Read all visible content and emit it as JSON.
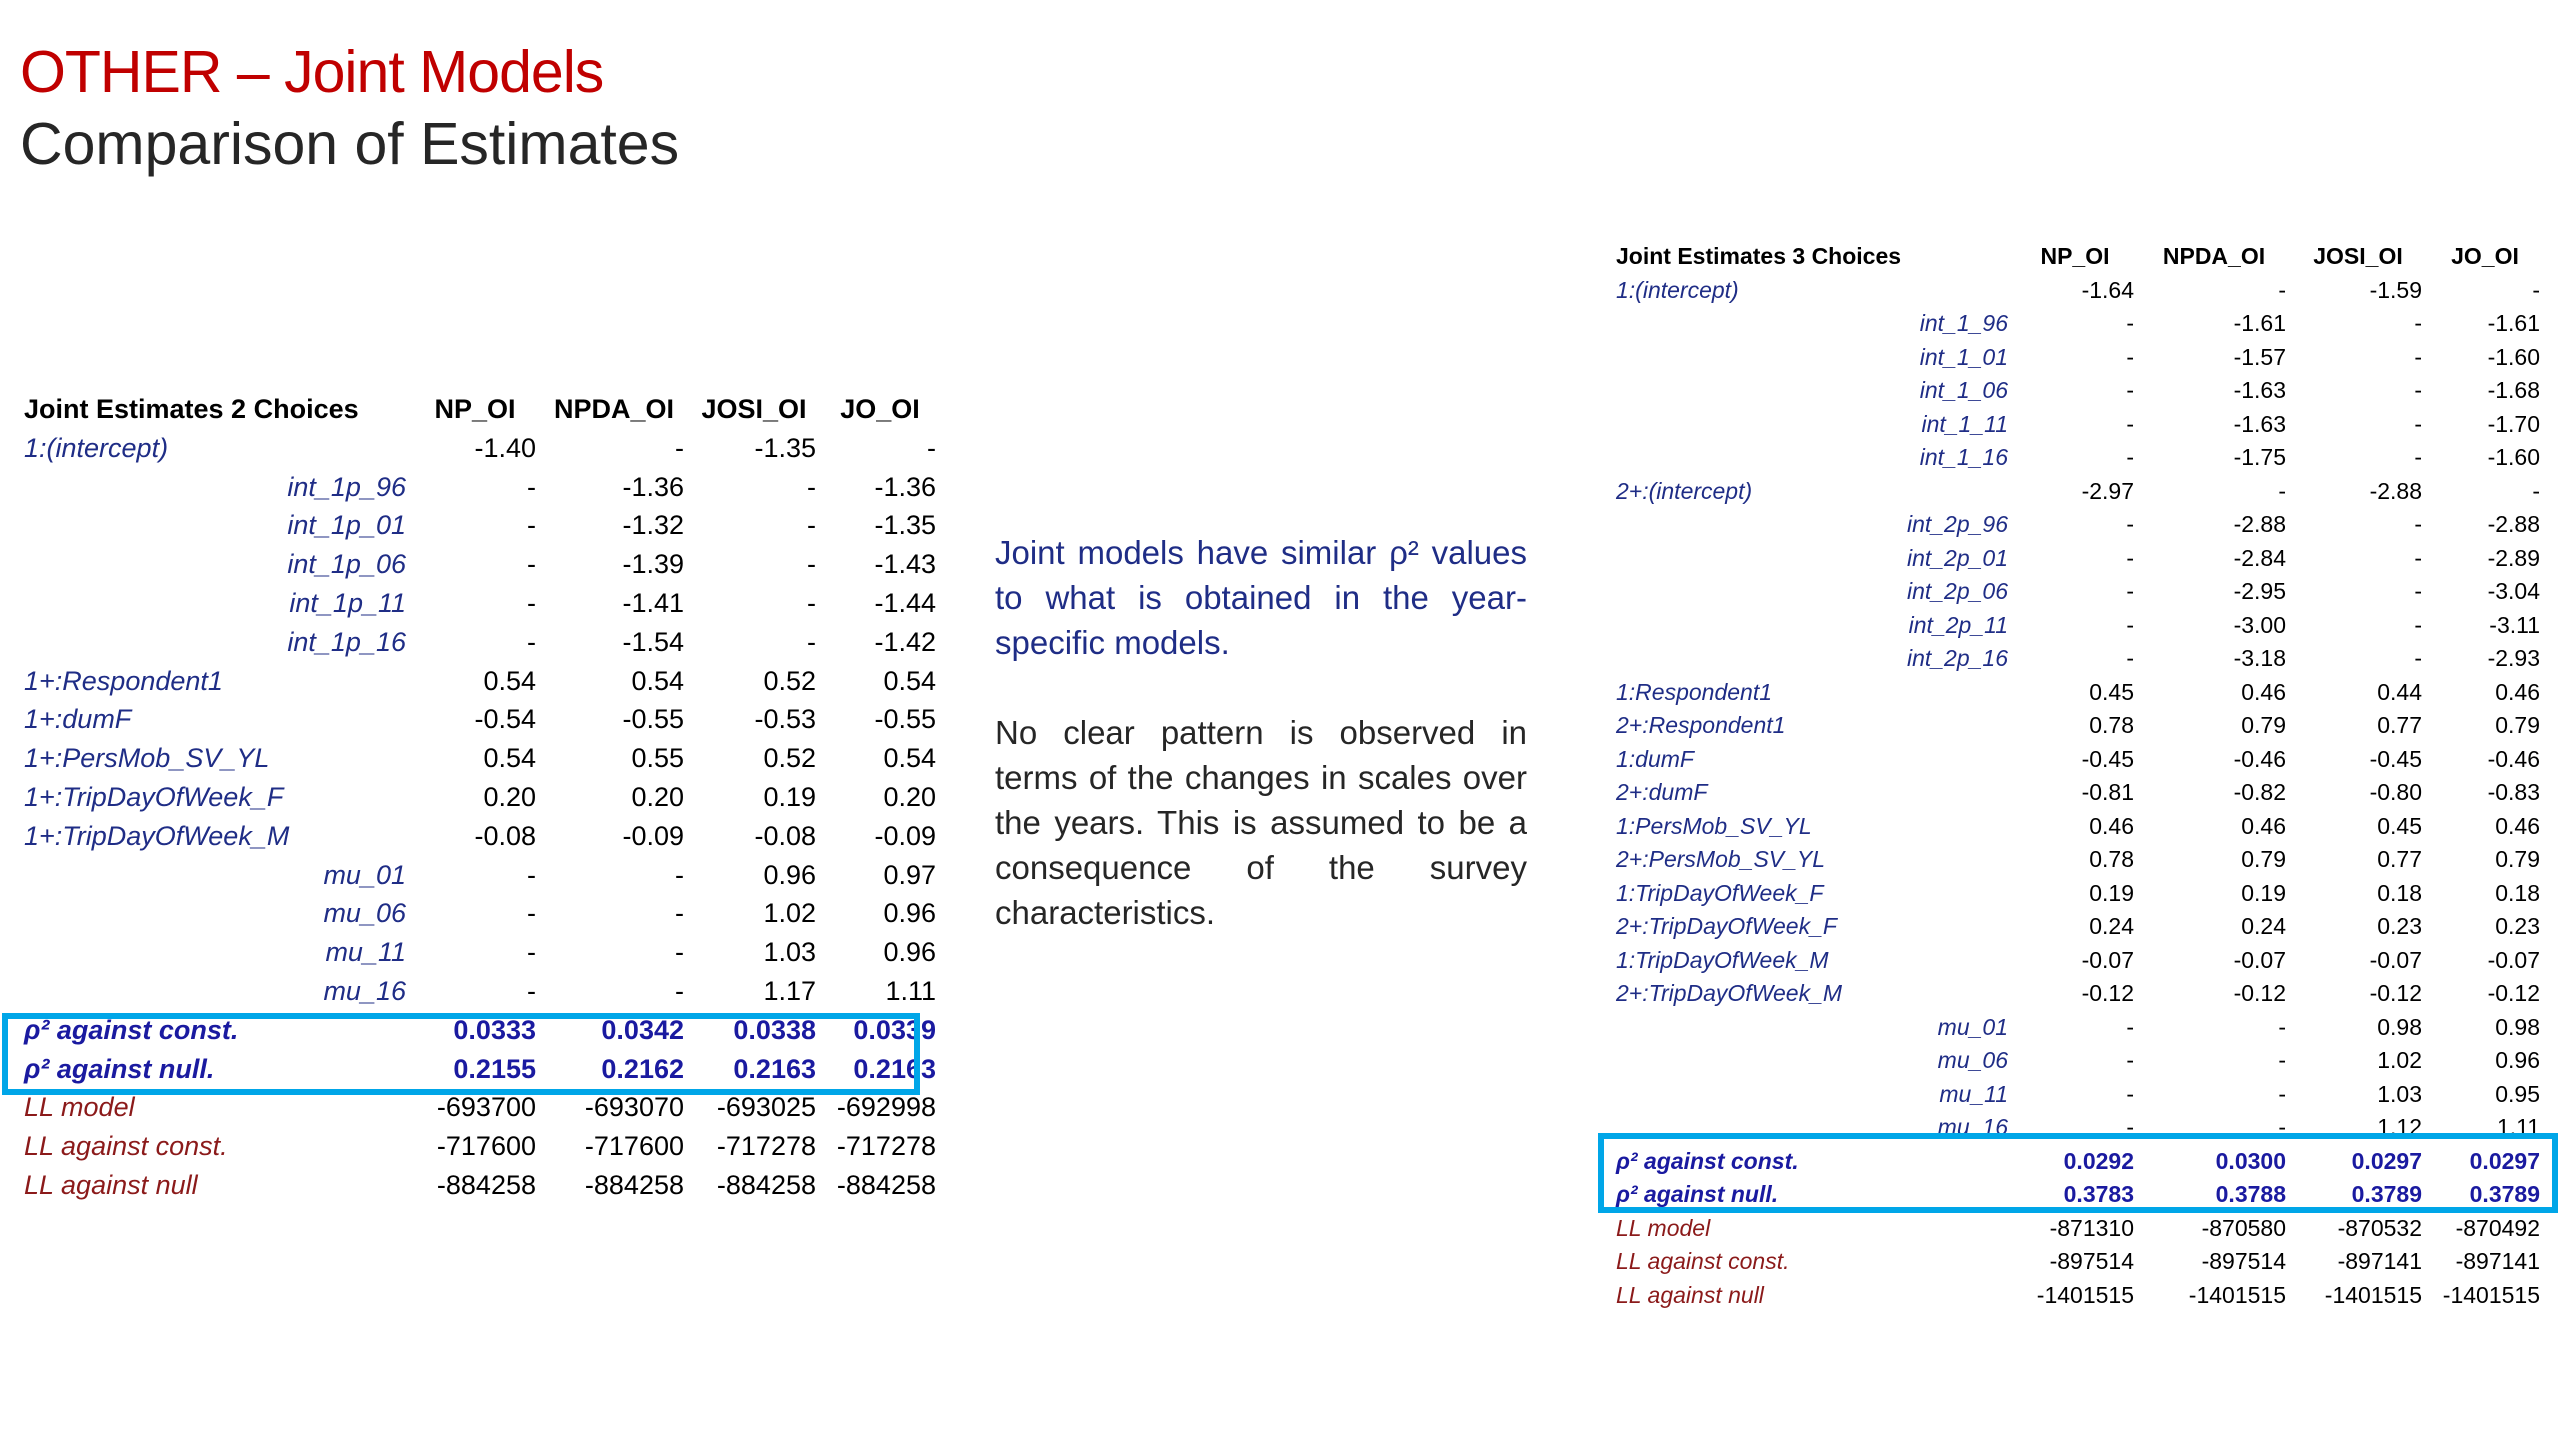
{
  "slide": {
    "title": "OTHER – Joint Models",
    "subtitle": "Comparison of Estimates",
    "paragraph1": "Joint models have similar ρ² values to what is obtained in the year-specific models.",
    "paragraph2": "No clear pattern is observed in terms of the changes in scales over the years. This is assumed to be a consequence of the survey characteristics."
  },
  "left_table": {
    "header": [
      "Joint Estimates 2 Choices",
      "NP_OI",
      "NPDA_OI",
      "JOSI_OI",
      "JO_OI"
    ],
    "rows": [
      {
        "label": "1:(intercept)",
        "values": [
          "-1.40",
          "-",
          "-1.35",
          "-"
        ]
      },
      {
        "label": "int_1p_96",
        "values": [
          "-",
          "-1.36",
          "-",
          "-1.36"
        ]
      },
      {
        "label": "int_1p_01",
        "values": [
          "-",
          "-1.32",
          "-",
          "-1.35"
        ]
      },
      {
        "label": "int_1p_06",
        "values": [
          "-",
          "-1.39",
          "-",
          "-1.43"
        ]
      },
      {
        "label": "int_1p_11",
        "values": [
          "-",
          "-1.41",
          "-",
          "-1.44"
        ]
      },
      {
        "label": "int_1p_16",
        "values": [
          "-",
          "-1.54",
          "-",
          "-1.42"
        ]
      },
      {
        "label": "1+:Respondent1",
        "values": [
          "0.54",
          "0.54",
          "0.52",
          "0.54"
        ]
      },
      {
        "label": "1+:dumF",
        "values": [
          "-0.54",
          "-0.55",
          "-0.53",
          "-0.55"
        ]
      },
      {
        "label": "1+:PersMob_SV_YL",
        "values": [
          "0.54",
          "0.55",
          "0.52",
          "0.54"
        ]
      },
      {
        "label": "1+:TripDayOfWeek_F",
        "values": [
          "0.20",
          "0.20",
          "0.19",
          "0.20"
        ]
      },
      {
        "label": "1+:TripDayOfWeek_M",
        "values": [
          "-0.08",
          "-0.09",
          "-0.08",
          "-0.09"
        ]
      },
      {
        "label": "mu_01",
        "values": [
          "-",
          "-",
          "0.96",
          "0.97"
        ]
      },
      {
        "label": "mu_06",
        "values": [
          "-",
          "-",
          "1.02",
          "0.96"
        ]
      },
      {
        "label": "mu_11",
        "values": [
          "-",
          "-",
          "1.03",
          "0.96"
        ]
      },
      {
        "label": "mu_16",
        "values": [
          "-",
          "-",
          "1.17",
          "1.11"
        ]
      },
      {
        "label": "ρ² against const.",
        "values": [
          "0.0333",
          "0.0342",
          "0.0338",
          "0.0339"
        ]
      },
      {
        "label": "ρ² against null.",
        "values": [
          "0.2155",
          "0.2162",
          "0.2163",
          "0.2163"
        ]
      },
      {
        "label": "LL model",
        "values": [
          "-693700",
          "-693070",
          "-693025",
          "-692998"
        ]
      },
      {
        "label": "LL against const.",
        "values": [
          "-717600",
          "-717600",
          "-717278",
          "-717278"
        ]
      },
      {
        "label": "LL against null",
        "values": [
          "-884258",
          "-884258",
          "-884258",
          "-884258"
        ]
      }
    ]
  },
  "right_table": {
    "header": [
      "Joint Estimates 3 Choices",
      "NP_OI",
      "NPDA_OI",
      "JOSI_OI",
      "JO_OI"
    ],
    "rows": [
      {
        "label": "1:(intercept)",
        "values": [
          "-1.64",
          "-",
          "-1.59",
          "-"
        ]
      },
      {
        "label": "int_1_96",
        "values": [
          "-",
          "-1.61",
          "-",
          "-1.61"
        ]
      },
      {
        "label": "int_1_01",
        "values": [
          "-",
          "-1.57",
          "-",
          "-1.60"
        ]
      },
      {
        "label": "int_1_06",
        "values": [
          "-",
          "-1.63",
          "-",
          "-1.68"
        ]
      },
      {
        "label": "int_1_11",
        "values": [
          "-",
          "-1.63",
          "-",
          "-1.70"
        ]
      },
      {
        "label": "int_1_16",
        "values": [
          "-",
          "-1.75",
          "-",
          "-1.60"
        ]
      },
      {
        "label": "2+:(intercept)",
        "values": [
          "-2.97",
          "-",
          "-2.88",
          "-"
        ]
      },
      {
        "label": "int_2p_96",
        "values": [
          "-",
          "-2.88",
          "-",
          "-2.88"
        ]
      },
      {
        "label": "int_2p_01",
        "values": [
          "-",
          "-2.84",
          "-",
          "-2.89"
        ]
      },
      {
        "label": "int_2p_06",
        "values": [
          "-",
          "-2.95",
          "-",
          "-3.04"
        ]
      },
      {
        "label": "int_2p_11",
        "values": [
          "-",
          "-3.00",
          "-",
          "-3.11"
        ]
      },
      {
        "label": "int_2p_16",
        "values": [
          "-",
          "-3.18",
          "-",
          "-2.93"
        ]
      },
      {
        "label": "1:Respondent1",
        "values": [
          "0.45",
          "0.46",
          "0.44",
          "0.46"
        ]
      },
      {
        "label": "2+:Respondent1",
        "values": [
          "0.78",
          "0.79",
          "0.77",
          "0.79"
        ]
      },
      {
        "label": "1:dumF",
        "values": [
          "-0.45",
          "-0.46",
          "-0.45",
          "-0.46"
        ]
      },
      {
        "label": "2+:dumF",
        "values": [
          "-0.81",
          "-0.82",
          "-0.80",
          "-0.83"
        ]
      },
      {
        "label": "1:PersMob_SV_YL",
        "values": [
          "0.46",
          "0.46",
          "0.45",
          "0.46"
        ]
      },
      {
        "label": "2+:PersMob_SV_YL",
        "values": [
          "0.78",
          "0.79",
          "0.77",
          "0.79"
        ]
      },
      {
        "label": "1:TripDayOfWeek_F",
        "values": [
          "0.19",
          "0.19",
          "0.18",
          "0.18"
        ]
      },
      {
        "label": "2+:TripDayOfWeek_F",
        "values": [
          "0.24",
          "0.24",
          "0.23",
          "0.23"
        ]
      },
      {
        "label": "1:TripDayOfWeek_M",
        "values": [
          "-0.07",
          "-0.07",
          "-0.07",
          "-0.07"
        ]
      },
      {
        "label": "2+:TripDayOfWeek_M",
        "values": [
          "-0.12",
          "-0.12",
          "-0.12",
          "-0.12"
        ]
      },
      {
        "label": "mu_01",
        "values": [
          "-",
          "-",
          "0.98",
          "0.98"
        ]
      },
      {
        "label": "mu_06",
        "values": [
          "-",
          "-",
          "1.02",
          "0.96"
        ]
      },
      {
        "label": "mu_11",
        "values": [
          "-",
          "-",
          "1.03",
          "0.95"
        ]
      },
      {
        "label": "mu_16",
        "values": [
          "-",
          "-",
          "1.12",
          "1.11"
        ]
      },
      {
        "label": "ρ² against const.",
        "values": [
          "0.0292",
          "0.0300",
          "0.0297",
          "0.0297"
        ]
      },
      {
        "label": "ρ² against null.",
        "values": [
          "0.3783",
          "0.3788",
          "0.3789",
          "0.3789"
        ]
      },
      {
        "label": "LL model",
        "values": [
          "-871310",
          "-870580",
          "-870532",
          "-870492"
        ]
      },
      {
        "label": "LL against const.",
        "values": [
          "-897514",
          "-897514",
          "-897141",
          "-897141"
        ]
      },
      {
        "label": "LL against null",
        "values": [
          "-1401515",
          "-1401515",
          "-1401515",
          "-1401515"
        ]
      }
    ]
  }
}
